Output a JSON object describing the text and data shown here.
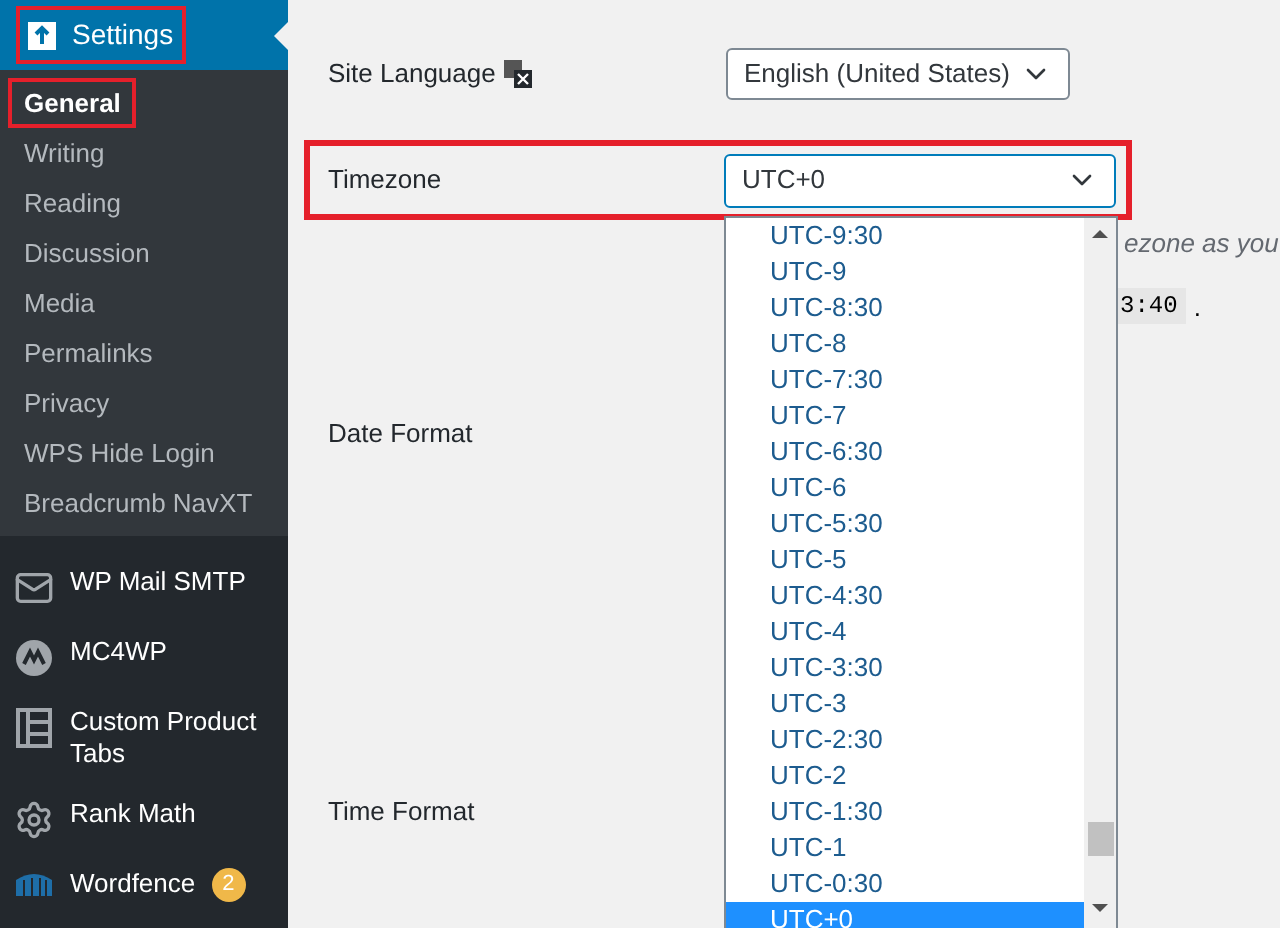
{
  "sidebar": {
    "menu": {
      "label": "Settings",
      "highlighted": true
    },
    "submenu": [
      {
        "label": "General",
        "selected": true,
        "highlighted": true
      },
      {
        "label": "Writing",
        "selected": false,
        "highlighted": false
      },
      {
        "label": "Reading",
        "selected": false,
        "highlighted": false
      },
      {
        "label": "Discussion",
        "selected": false,
        "highlighted": false
      },
      {
        "label": "Media",
        "selected": false,
        "highlighted": false
      },
      {
        "label": "Permalinks",
        "selected": false,
        "highlighted": false
      },
      {
        "label": "Privacy",
        "selected": false,
        "highlighted": false
      },
      {
        "label": "WPS Hide Login",
        "selected": false,
        "highlighted": false
      },
      {
        "label": "Breadcrumb NavXT",
        "selected": false,
        "highlighted": false
      }
    ],
    "items": [
      {
        "kind": "mail",
        "label": "WP Mail SMTP"
      },
      {
        "kind": "mc",
        "label": "MC4WP"
      },
      {
        "kind": "tabs",
        "label": "Custom Product Tabs"
      },
      {
        "kind": "gear",
        "label": "Rank Math"
      },
      {
        "kind": "shield",
        "label": "Wordfence",
        "badge": "2"
      }
    ]
  },
  "form": {
    "site_language": {
      "label": "Site Language",
      "value": "English (United States)"
    },
    "timezone": {
      "label": "Timezone",
      "value": "UTC+0",
      "highlighted": true,
      "hint": "ezone as you",
      "time": "3:40",
      "time_end": "."
    },
    "date_format": {
      "label": "Date Format"
    },
    "time_format": {
      "label": "Time Format"
    }
  },
  "dropdown": {
    "options": [
      {
        "label": "UTC-9:30",
        "selected": false
      },
      {
        "label": "UTC-9",
        "selected": false
      },
      {
        "label": "UTC-8:30",
        "selected": false
      },
      {
        "label": "UTC-8",
        "selected": false
      },
      {
        "label": "UTC-7:30",
        "selected": false
      },
      {
        "label": "UTC-7",
        "selected": false
      },
      {
        "label": "UTC-6:30",
        "selected": false
      },
      {
        "label": "UTC-6",
        "selected": false
      },
      {
        "label": "UTC-5:30",
        "selected": false
      },
      {
        "label": "UTC-5",
        "selected": false
      },
      {
        "label": "UTC-4:30",
        "selected": false
      },
      {
        "label": "UTC-4",
        "selected": false
      },
      {
        "label": "UTC-3:30",
        "selected": false
      },
      {
        "label": "UTC-3",
        "selected": false
      },
      {
        "label": "UTC-2:30",
        "selected": false
      },
      {
        "label": "UTC-2",
        "selected": false
      },
      {
        "label": "UTC-1:30",
        "selected": false
      },
      {
        "label": "UTC-1",
        "selected": false
      },
      {
        "label": "UTC-0:30",
        "selected": false
      },
      {
        "label": "UTC+0",
        "selected": true
      }
    ]
  }
}
